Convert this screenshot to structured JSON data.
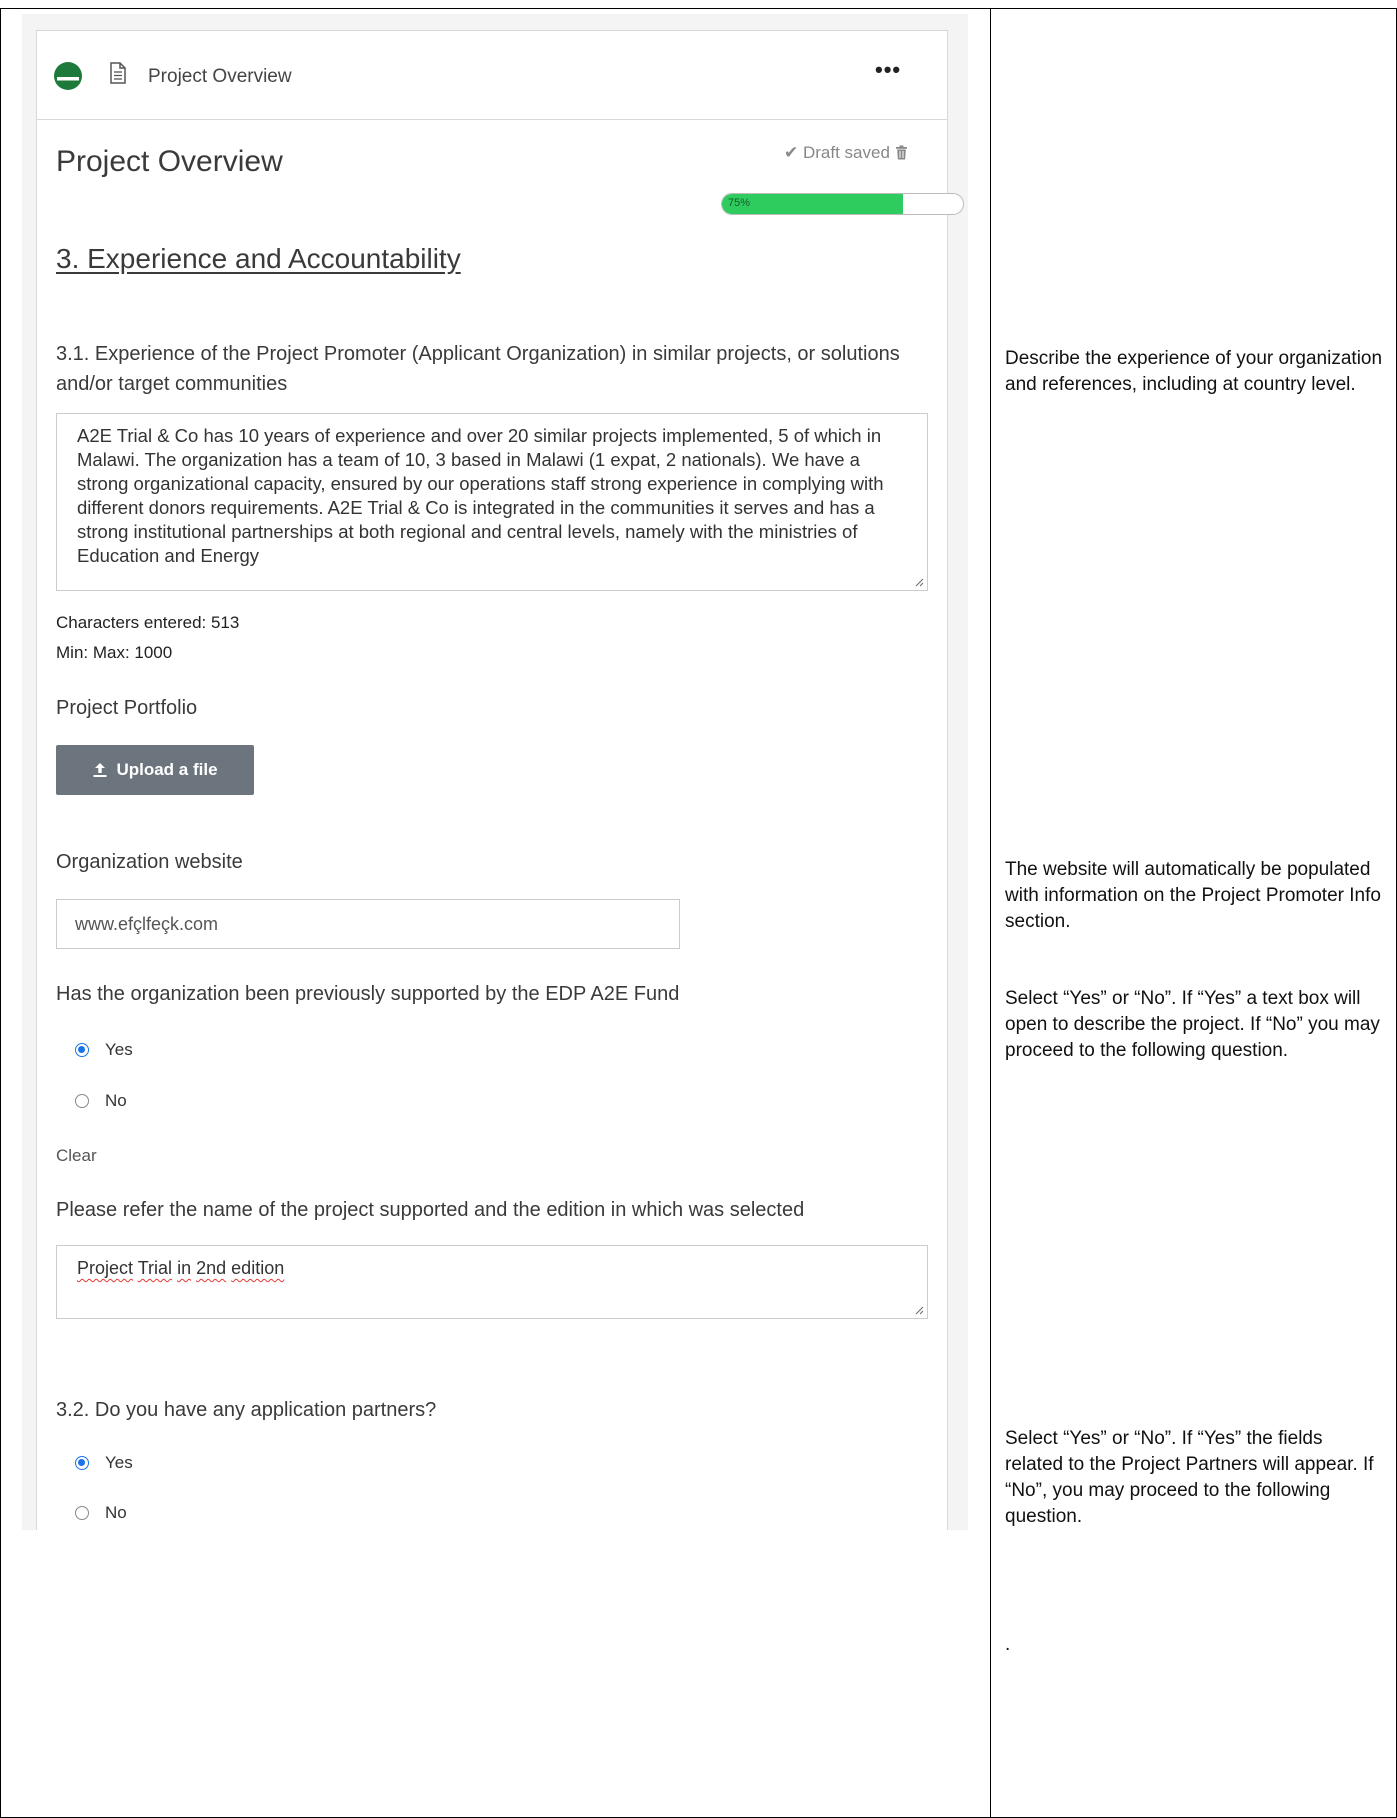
{
  "header": {
    "title": "Project Overview",
    "more_label": "•••"
  },
  "page": {
    "title": "Project Overview",
    "draft_status": "✔ Draft saved",
    "progress": {
      "label": "75%",
      "value": 0.75,
      "color": "#2ecc5e"
    }
  },
  "section": {
    "title": "3. Experience and Accountability"
  },
  "q31": {
    "label": "3.1. Experience of the Project Promoter (Applicant Organization) in similar projects, or solutions and/or target communities",
    "value": "A2E Trial & Co has 10 years of experience and over 20 similar projects implemented, 5 of which in Malawi. The organization has a team of 10, 3 based in Malawi (1 expat, 2 nationals). We have a strong organizational capacity, ensured by our operations staff strong experience in complying with different donors requirements. A2E Trial & Co is integrated in the communities it serves and has a strong institutional partnerships at both regional and central levels, namely with the ministries of Education and Energy",
    "char_count": "Characters entered: 513",
    "min_max": "Min: Max: 1000"
  },
  "portfolio": {
    "label": "Project Portfolio",
    "upload_label": "Upload a file"
  },
  "website": {
    "label": "Organization website",
    "value": "www.efçlfeçk.com"
  },
  "previous_support": {
    "label": "Has the organization been previously supported by the EDP A2E Fund",
    "options": [
      "Yes",
      "No"
    ],
    "selected": "Yes",
    "clear_label": "Clear"
  },
  "project_name": {
    "label": "Please refer the name of the project supported and the edition in which was selected",
    "value_words": [
      "Project",
      "Trial",
      "in",
      "2nd",
      "edition"
    ]
  },
  "q32": {
    "label": "3.2. Do you have any application partners?",
    "options": [
      "Yes",
      "No"
    ],
    "selected": "Yes"
  },
  "notes": {
    "experience": "Describe the experience of your organization and references, including at country level.",
    "website": "The website will automatically be populated with information on the Project Promoter Info section.",
    "previous_support": "Select “Yes” or “No”. If “Yes” a text box will open to describe the project. If “No” you may proceed to the following question.",
    "partners": "Select “Yes” or “No”. If “Yes” the fields related to the Project Partners will appear. If “No”, you may proceed to the following question.",
    "dot": "."
  },
  "colors": {
    "accent": "#1a73e8",
    "progress": "#2ecc5e",
    "button": "#6c757d",
    "status_icon": "#1e7a3a"
  }
}
